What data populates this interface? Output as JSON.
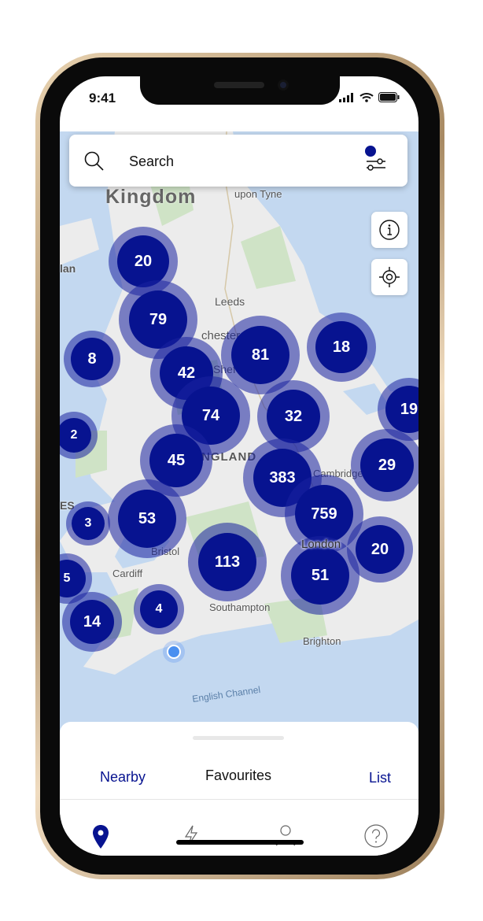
{
  "status": {
    "time": "9:41"
  },
  "search": {
    "placeholder": "Search"
  },
  "map": {
    "labels": [
      "Kingdom",
      "upon Tyne",
      "Leeds",
      "chester",
      "Shef",
      "NGLAND",
      "Cambridge",
      "Bristol",
      "Cardiff",
      "Southampton",
      "Brighton",
      "London",
      "English Channel",
      "lan",
      "ES"
    ],
    "clusters": [
      "20",
      "79",
      "8",
      "42",
      "81",
      "18",
      "74",
      "32",
      "19",
      "2",
      "45",
      "383",
      "29",
      "3",
      "53",
      "759",
      "20",
      "113",
      "51",
      "5",
      "4",
      "14"
    ]
  },
  "sheet": {
    "tabs": {
      "nearby": "Nearby",
      "favourites": "Favourites",
      "list": "List"
    }
  },
  "colors": {
    "accent": "#071390",
    "sea": "#c3d8f0",
    "land": "#ececec"
  }
}
